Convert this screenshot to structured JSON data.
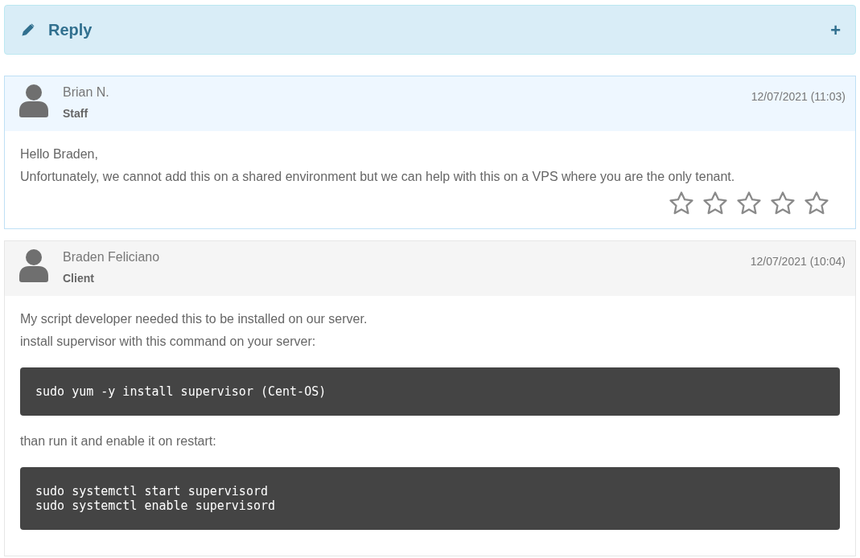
{
  "reply_bar": {
    "title": "Reply",
    "expand_symbol": "+"
  },
  "messages": [
    {
      "kind": "staff",
      "author": "Brian N.",
      "role": "Staff",
      "date": "12/07/2021 (11:03)",
      "stars": 0,
      "blocks": [
        {
          "kind": "text",
          "lines": [
            "Hello Braden,",
            "Unfortunately, we cannot add this on a shared environment but we can help with this on a VPS where you are the only tenant."
          ]
        }
      ]
    },
    {
      "kind": "client",
      "author": "Braden Feliciano",
      "role": "Client",
      "date": "12/07/2021 (10:04)",
      "blocks": [
        {
          "kind": "text",
          "lines": [
            "My script developer needed this to be installed on our server.",
            "install supervisor with this command on your server:"
          ]
        },
        {
          "kind": "code",
          "lines": [
            "sudo yum -y install supervisor (Cent-OS)"
          ]
        },
        {
          "kind": "text",
          "lines": [
            "than run it and enable it on restart:"
          ]
        },
        {
          "kind": "code",
          "lines": [
            "sudo systemctl start supervisord",
            "sudo systemctl enable supervisord"
          ]
        }
      ]
    }
  ]
}
